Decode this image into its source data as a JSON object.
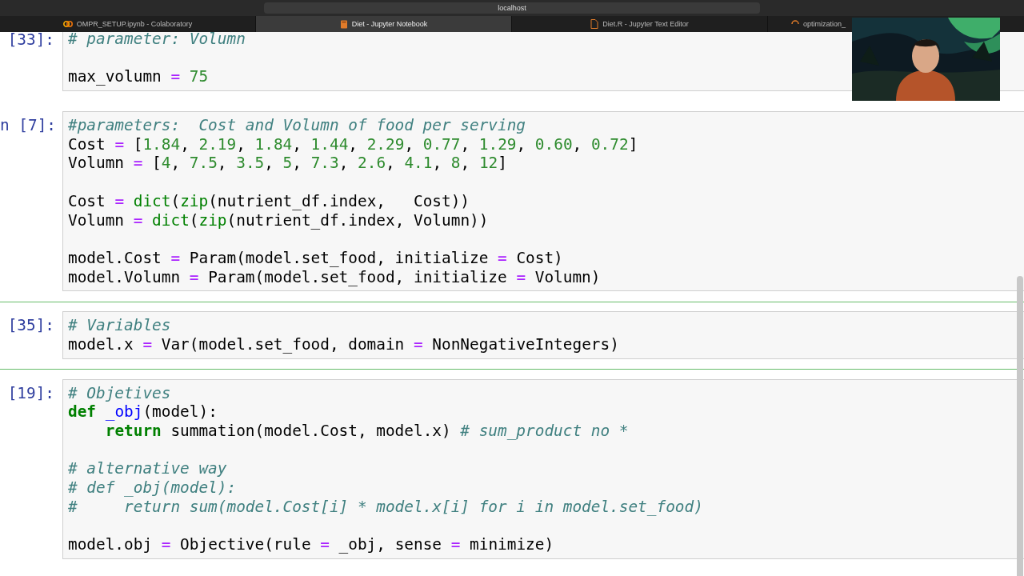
{
  "browser": {
    "address": "localhost",
    "tabs": [
      {
        "label": "OMPR_SETUP.ipynb - Colaboratory",
        "selected": false
      },
      {
        "label": "Diet - Jupyter Notebook",
        "selected": true
      },
      {
        "label": "Diet.R - Jupyter Text Editor",
        "selected": false
      },
      {
        "label": "optimization_",
        "selected": false
      }
    ]
  },
  "cells": [
    {
      "prompt": "[33]:",
      "selected": false,
      "lines": [
        {
          "kind": "code",
          "text": "# parameter: Volumn"
        },
        {
          "kind": "blank"
        },
        {
          "kind": "code",
          "text": "max_volumn = 75"
        }
      ]
    },
    {
      "prompt": "n [7]:",
      "selected": false,
      "lines": [
        {
          "kind": "code",
          "text": "#parameters:  Cost and Volumn of food per serving"
        },
        {
          "kind": "code",
          "text": "Cost = [1.84, 2.19, 1.84, 1.44, 2.29, 0.77, 1.29, 0.60, 0.72]"
        },
        {
          "kind": "code",
          "text": "Volumn = [4, 7.5, 3.5, 5, 7.3, 2.6, 4.1, 8, 12]"
        },
        {
          "kind": "blank"
        },
        {
          "kind": "code",
          "text": "Cost = dict(zip(nutrient_df.index,   Cost))"
        },
        {
          "kind": "code",
          "text": "Volumn = dict(zip(nutrient_df.index, Volumn))"
        },
        {
          "kind": "blank"
        },
        {
          "kind": "code",
          "text": "model.Cost = Param(model.set_food, initialize = Cost)"
        },
        {
          "kind": "code",
          "text": "model.Volumn = Param(model.set_food, initialize = Volumn)"
        }
      ]
    },
    {
      "prompt": "[35]:",
      "selected": true,
      "lines": [
        {
          "kind": "code",
          "text": "# Variables"
        },
        {
          "kind": "code",
          "text": "model.x = Var(model.set_food, domain = NonNegativeIntegers)"
        }
      ]
    },
    {
      "prompt": "[19]:",
      "selected": false,
      "lines": [
        {
          "kind": "code",
          "text": "# Objetives"
        },
        {
          "kind": "code",
          "text": "def _obj(model):"
        },
        {
          "kind": "code",
          "text": "    return summation(model.Cost, model.x) # sum_product no *"
        },
        {
          "kind": "blank"
        },
        {
          "kind": "code",
          "text": "# alternative way"
        },
        {
          "kind": "code",
          "text": "# def _obj(model):"
        },
        {
          "kind": "code",
          "text": "#     return sum(model.Cost[i] * model.x[i] for i in model.set_food)"
        },
        {
          "kind": "blank"
        },
        {
          "kind": "code",
          "text": "model.obj = Objective(rule = _obj, sense = minimize)"
        }
      ]
    }
  ]
}
